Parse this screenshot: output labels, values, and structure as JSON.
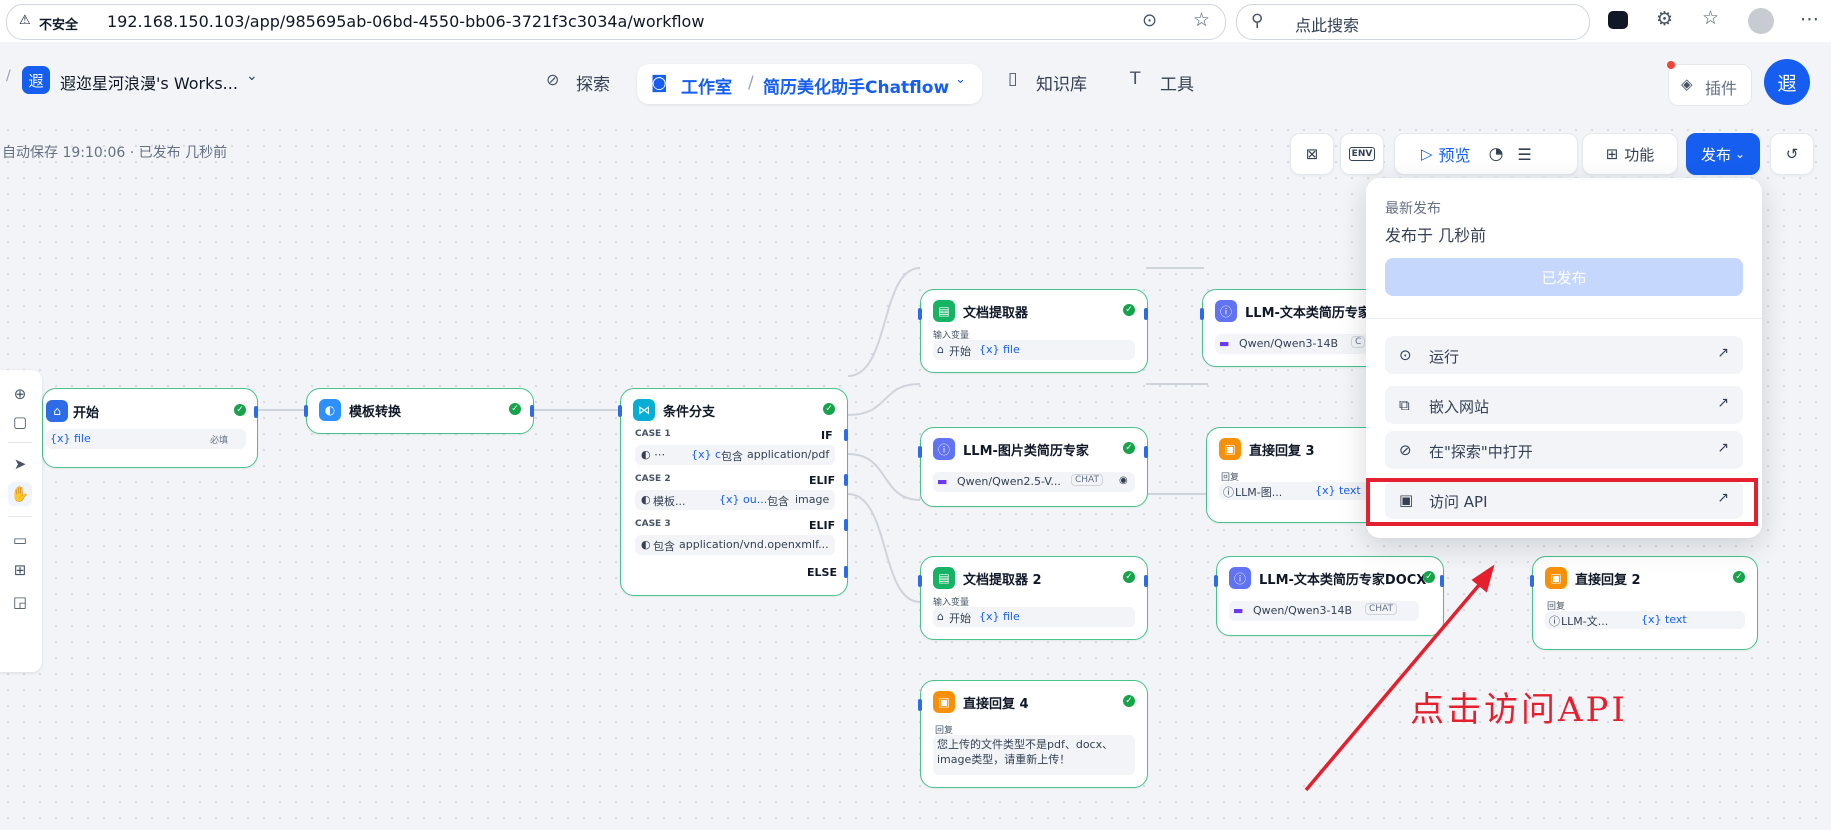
{
  "browser": {
    "security_label": "不安全",
    "url": "192.168.150.103/app/985695ab-06bd-4550-bb06-3721f3c3034a/workflow",
    "search_placeholder": "点此搜索"
  },
  "header": {
    "workspace_avatar": "遐",
    "workspace_name": "遐迩星河浪漫's Works...",
    "nav_explore": "探索",
    "nav_studio": "工作室",
    "app_name": "简历美化助手Chatflow",
    "nav_knowledge": "知识库",
    "nav_tools": "工具",
    "plugins_label": "插件",
    "user_avatar": "遐"
  },
  "status": {
    "autosave": "自动保存 19:10:06 · 已发布 几秒前"
  },
  "toolbar": {
    "env_label": "ENV",
    "preview_label": "预览",
    "features_label": "功能",
    "publish_label": "发布"
  },
  "publish_menu": {
    "latest_title": "最新发布",
    "published_time": "发布于 几秒前",
    "published_button": "已发布",
    "items": [
      {
        "label": "运行",
        "icon": "play-circle-icon"
      },
      {
        "label": "嵌入网站",
        "icon": "embed-icon"
      },
      {
        "label": "在\"探索\"中打开",
        "icon": "compass-icon"
      },
      {
        "label": "访问 API",
        "icon": "terminal-icon"
      }
    ],
    "highlight_color": "#e5202e"
  },
  "annotation": {
    "text": "点击访问API",
    "color": "#e5202e"
  },
  "nodes": {
    "start": {
      "title": "开始",
      "var": "{x} file",
      "required": "必填"
    },
    "template": {
      "title": "模板转换"
    },
    "branch": {
      "title": "条件分支",
      "case1_label": "CASE 1",
      "case1_kind": "IF",
      "case1_var": "{x} c",
      "case1_op": "包含",
      "case1_value": "application/pdf",
      "case2_label": "CASE 2",
      "case2_kind": "ELIF",
      "case2_src": "模板...",
      "case2_var": "{x} ou...",
      "case2_op": "包含",
      "case2_value": "image",
      "case3_label": "CASE 3",
      "case3_kind": "ELIF",
      "case3_op": "包含",
      "case3_value": "application/vnd.openxmlf...",
      "else_label": "ELSE"
    },
    "extractor1": {
      "title": "文档提取器",
      "sub": "输入变量",
      "src": "开始",
      "var": "{x} file"
    },
    "llm_text1": {
      "title": "LLM-文本类简历专家",
      "model": "Qwen/Qwen3-14B",
      "tag": "C"
    },
    "llm_image": {
      "title": "LLM-图片类简历专家",
      "model": "Qwen/Qwen2.5-V...",
      "tag": "CHAT"
    },
    "reply3": {
      "title": "直接回复 3",
      "sub": "回复",
      "src": "LLM-图...",
      "var": "{x} text"
    },
    "extractor2": {
      "title": "文档提取器 2",
      "sub": "输入变量",
      "src": "开始",
      "var": "{x} file"
    },
    "llm_docx": {
      "title": "LLM-文本类简历专家DOCX",
      "model": "Qwen/Qwen3-14B",
      "tag": "CHAT"
    },
    "reply2": {
      "title": "直接回复 2",
      "sub": "回复",
      "src": "LLM-文...",
      "var": "{x} text"
    },
    "reply4": {
      "title": "直接回复 4",
      "sub": "回复",
      "body": "您上传的文件类型不是pdf、docx、image类型，请重新上传！"
    }
  },
  "colors": {
    "accent": "#155eef",
    "node_border": "#47c28b",
    "success": "#17a34a",
    "highlight": "#e5202e"
  }
}
